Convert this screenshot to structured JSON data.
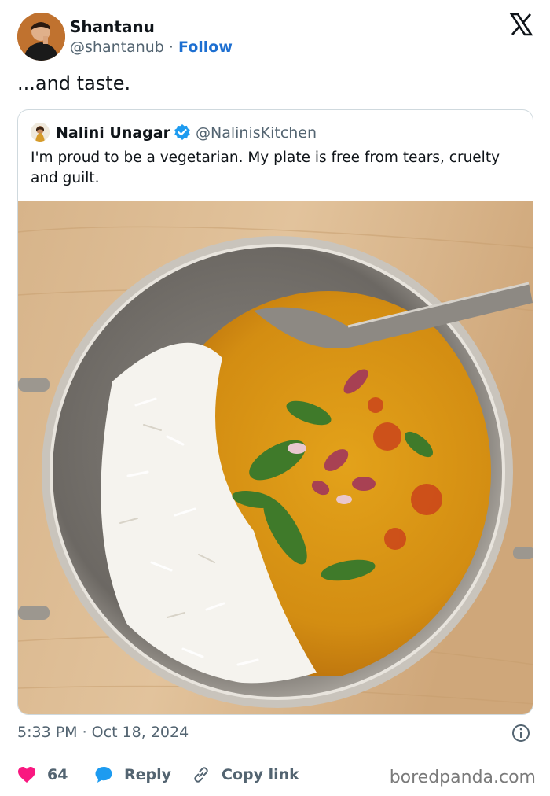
{
  "author": {
    "name": "Shantanu",
    "handle": "@shantanub",
    "separator": "·",
    "follow_label": "Follow"
  },
  "tweet": {
    "text": "...and taste."
  },
  "quoted": {
    "name": "Nalini Unagar",
    "handle": "@NalinisKitchen",
    "text": "I'm proud to be a vegetarian. My plate is free from tears, cruelty and guilt.",
    "media": "photo of a steel bowl with white rice and yellow dal topped with herbs and onions"
  },
  "meta": {
    "timestamp": "5:33 PM · Oct 18, 2024"
  },
  "actions": {
    "likes_count": "64",
    "reply_label": "Reply",
    "copy_link_label": "Copy link"
  },
  "watermark": "boredpanda.com",
  "colors": {
    "accent": "#1d6fd1",
    "heart": "#f91880",
    "reply_bubble": "#1d9bf0",
    "muted": "#536471",
    "verified": "#1d9bf0"
  },
  "icons": [
    "x-logo-icon",
    "verified-icon",
    "info-icon",
    "heart-icon",
    "reply-icon",
    "link-icon"
  ]
}
